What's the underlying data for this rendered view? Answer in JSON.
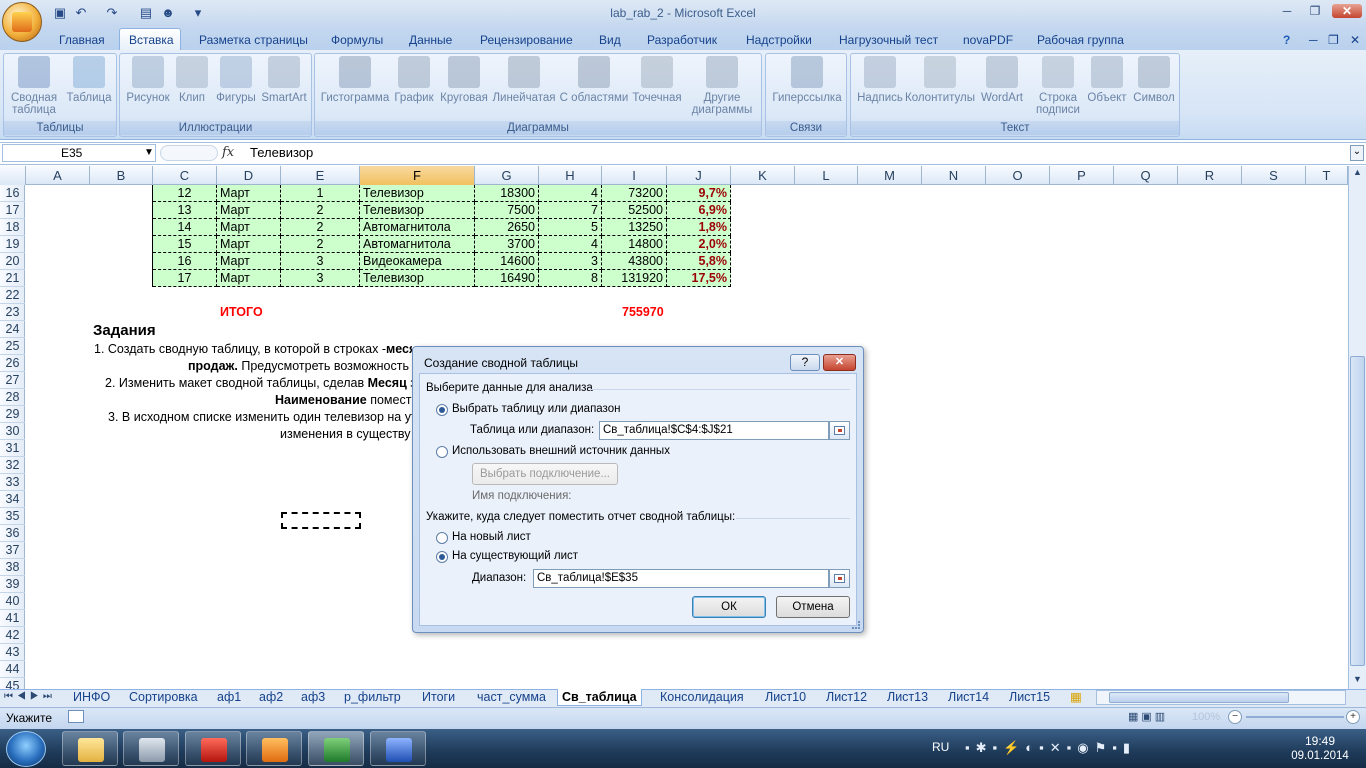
{
  "app": {
    "title": "lab_rab_2 - Microsoft Excel"
  },
  "ribbon": {
    "tabs": [
      "Главная",
      "Вставка",
      "Разметка страницы",
      "Формулы",
      "Данные",
      "Рецензирование",
      "Вид",
      "Разработчик",
      "Надстройки",
      "Нагрузочный тест",
      "novaPDF",
      "Рабочая группа"
    ],
    "active_tab": "Вставка",
    "groups": {
      "tables": {
        "label": "Таблицы",
        "buttons": [
          "Сводная таблица",
          "Таблица"
        ]
      },
      "illustrations": {
        "label": "Иллюстрации",
        "buttons": [
          "Рисунок",
          "Клип",
          "Фигуры",
          "SmartArt"
        ]
      },
      "charts": {
        "label": "Диаграммы",
        "buttons": [
          "Гистограмма",
          "График",
          "Круговая",
          "Линейчатая",
          "С областями",
          "Точечная",
          "Другие диаграммы"
        ]
      },
      "links": {
        "label": "Связи",
        "buttons": [
          "Гиперссылка"
        ]
      },
      "text": {
        "label": "Текст",
        "buttons": [
          "Надпись",
          "Колонтитулы",
          "WordArt",
          "Строка подписи",
          "Объект",
          "Символ"
        ]
      }
    }
  },
  "formula_bar": {
    "name_box": "E35",
    "fx": "fx",
    "content": "Телевизор"
  },
  "columns": [
    "A",
    "B",
    "C",
    "D",
    "E",
    "F",
    "G",
    "H",
    "I",
    "J",
    "K",
    "L",
    "M",
    "N",
    "O",
    "P",
    "Q",
    "R",
    "S",
    "T"
  ],
  "selected_column": "F",
  "rows": [
    "16",
    "17",
    "18",
    "19",
    "20",
    "21",
    "22",
    "23",
    "24",
    "25",
    "26",
    "27",
    "28",
    "29",
    "30",
    "31",
    "32",
    "33",
    "34",
    "35",
    "36",
    "37",
    "38",
    "39",
    "40",
    "41",
    "42",
    "43",
    "44",
    "45"
  ],
  "table_rows": [
    [
      "12",
      "Март",
      "1",
      "Телевизор",
      "18300",
      "4",
      "73200",
      "9,7%"
    ],
    [
      "13",
      "Март",
      "2",
      "Телевизор",
      "7500",
      "7",
      "52500",
      "6,9%"
    ],
    [
      "14",
      "Март",
      "2",
      "Автомагнитола",
      "2650",
      "5",
      "13250",
      "1,8%"
    ],
    [
      "15",
      "Март",
      "2",
      "Автомагнитола",
      "3700",
      "4",
      "14800",
      "2,0%"
    ],
    [
      "16",
      "Март",
      "3",
      "Видеокамера",
      "14600",
      "3",
      "43800",
      "5,8%"
    ],
    [
      "17",
      "Март",
      "3",
      "Телевизор",
      "16490",
      "8",
      "131920",
      "17,5%"
    ]
  ],
  "total": {
    "label": "ИТОГО",
    "value": "755970"
  },
  "tasks": {
    "heading": "Задания",
    "line1": "1. Создать сводную таблицу, в  которой в строках -",
    "line1_bold": "месяц",
    "line2_bold": "продаж.",
    "line2": " Предусмотреть возможность ",
    "line3": "2. Изменить макет сводной таблицы, сделав ",
    "line3_bold": "Месяц",
    "line3_tail": " за",
    "line4_bold": "Наименование",
    "line4": " помести",
    "line5": "3. В исходном списке изменить один телевизор на ут",
    "line6": "изменения в существу"
  },
  "dialog": {
    "title": "Создание сводной таблицы",
    "help": "?",
    "close": "✕",
    "section1": "Выберите данные для анализа",
    "opt_range": "Выбрать таблицу или диапазон",
    "range_label": "Таблица или диапазон:",
    "range_value": "Св_таблица!$C$4:$J$21",
    "opt_external": "Использовать внешний источник данных",
    "choose_conn": "Выбрать подключение...",
    "conn_name": "Имя подключения:",
    "section2": "Укажите, куда следует поместить отчет сводной таблицы:",
    "opt_new": "На новый лист",
    "opt_existing": "На существующий лист",
    "dest_label": "Диапазон:",
    "dest_value": "Св_таблица!$E$35",
    "ok": "ОК",
    "cancel": "Отмена"
  },
  "sheets": [
    "ИНФО",
    "Сортировка",
    "аф1",
    "аф2",
    "аф3",
    "р_фильтр",
    "Итоги",
    "част_сумма",
    "Св_таблица",
    "Консолидация",
    "Лист10",
    "Лист12",
    "Лист13",
    "Лист14",
    "Лист15"
  ],
  "active_sheet": "Св_таблица",
  "status": {
    "mode": "Укажите",
    "zoom": "100%"
  },
  "taskbar": {
    "lang": "RU",
    "time": "19:49",
    "date": "09.01.2014"
  },
  "colors": {
    "table_fill": "#ccffcc",
    "red": "#ff0000",
    "percent": "#9c0006"
  }
}
